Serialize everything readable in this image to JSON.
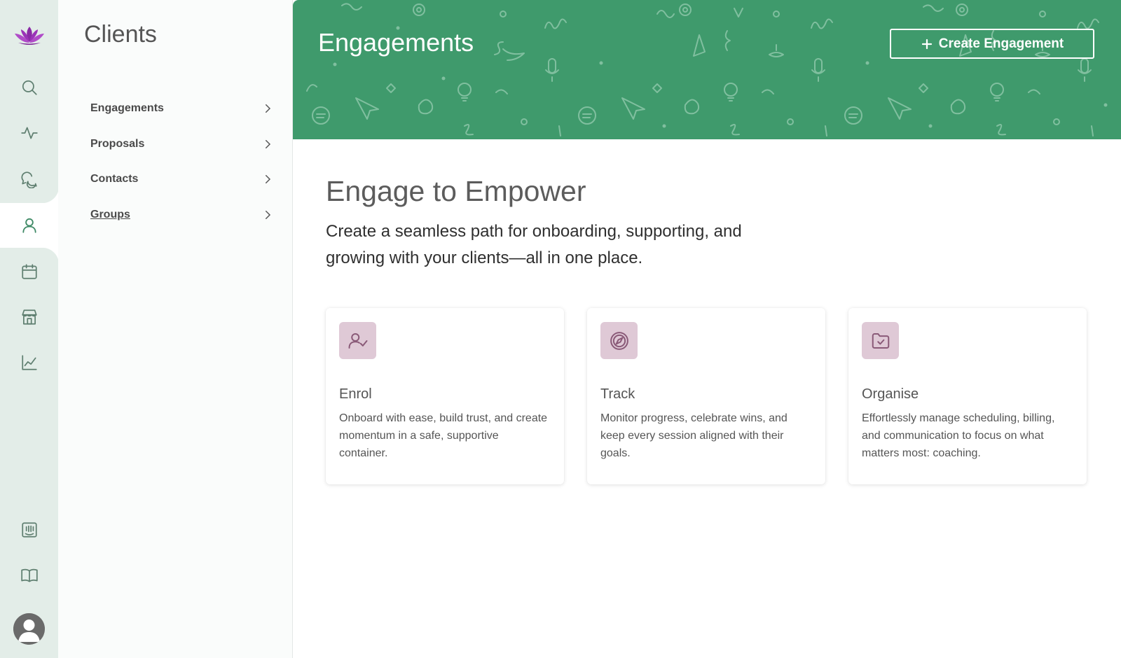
{
  "colors": {
    "accent_green": "#3f9a6c",
    "rail_bg": "#e3ede8",
    "logo_purple": "#8a2aa6",
    "card_icon_bg": "#dfc9d6",
    "card_icon_fg": "#8a5a78"
  },
  "rail": {
    "logo_icon": "lotus-logo",
    "items": [
      {
        "name": "search-icon"
      },
      {
        "name": "activity-icon"
      },
      {
        "name": "messages-icon"
      },
      {
        "name": "clients-icon",
        "active": true
      },
      {
        "name": "calendar-icon"
      },
      {
        "name": "store-icon"
      },
      {
        "name": "analytics-icon"
      },
      {
        "name": "feedback-icon"
      },
      {
        "name": "library-icon"
      }
    ],
    "avatar_icon": "user-avatar"
  },
  "subnav": {
    "title": "Clients",
    "items": [
      {
        "label": "Engagements"
      },
      {
        "label": "Proposals"
      },
      {
        "label": "Contacts"
      },
      {
        "label": "Groups"
      }
    ]
  },
  "hero": {
    "title": "Engagements",
    "create_label": "Create Engagement"
  },
  "content": {
    "headline": "Engage to Empower",
    "subhead": "Create a seamless path for onboarding, supporting, and growing with your clients—all in one place.",
    "cards": [
      {
        "icon": "user-check-icon",
        "title": "Enrol",
        "desc": "Onboard with ease, build trust, and create momentum in a safe, supportive container."
      },
      {
        "icon": "compass-icon",
        "title": "Track",
        "desc": "Monitor progress, celebrate wins, and keep every session aligned with their goals."
      },
      {
        "icon": "folder-check-icon",
        "title": "Organise",
        "desc": "Effortlessly manage scheduling, billing, and communication to focus on what matters most: coaching."
      }
    ]
  }
}
